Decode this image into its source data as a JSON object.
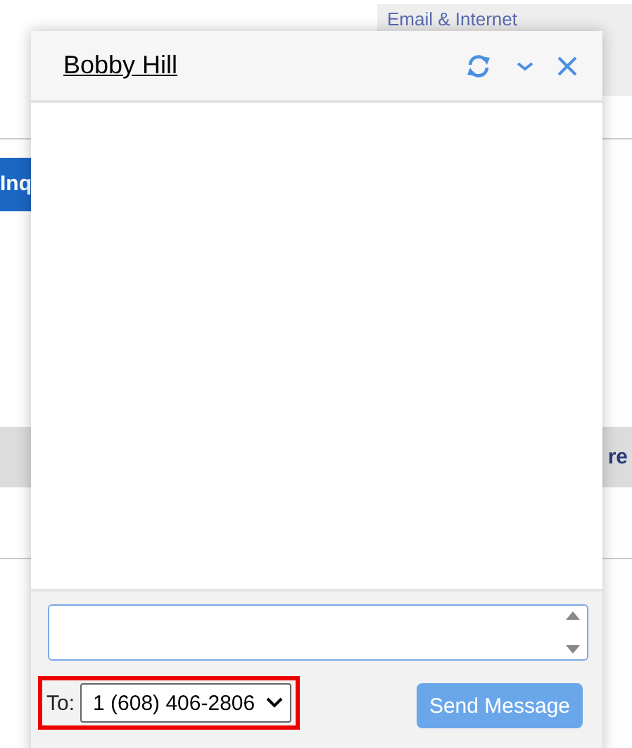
{
  "background": {
    "tab_label": "Email & Internet",
    "button_label": "Inq",
    "band_label": "re"
  },
  "chat_window": {
    "title": "Bobby Hill",
    "to_label": "To:",
    "recipient": "1 (608) 406-2806",
    "send_button": {
      "label": "Send Message",
      "disabled": true
    }
  }
}
